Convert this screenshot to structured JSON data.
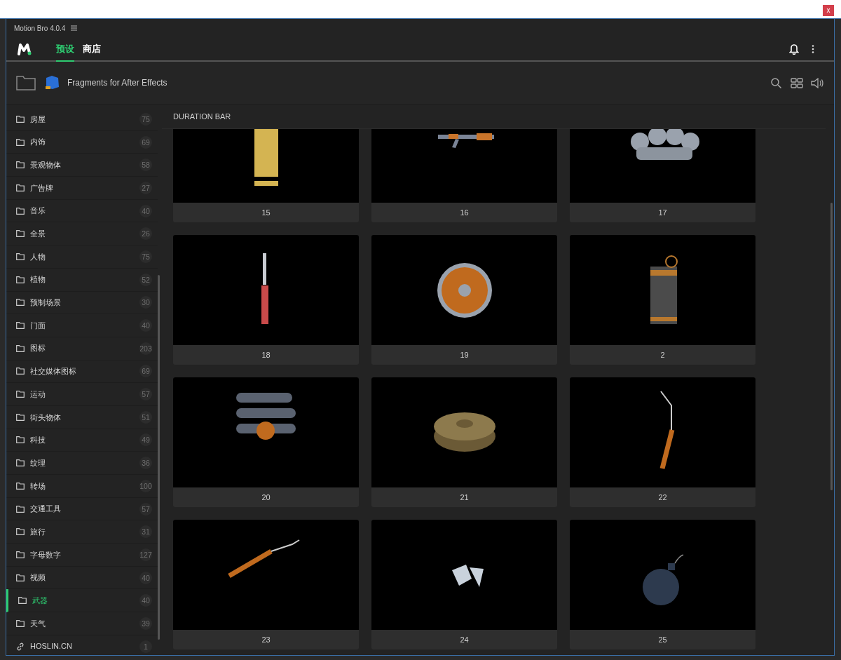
{
  "window": {
    "title": "Motion Bro 4.0.4",
    "close": "x"
  },
  "tabs": [
    {
      "label": "预设",
      "selected": true
    },
    {
      "label": "商店",
      "selected": false
    }
  ],
  "toolbar": {
    "pack": "Fragments for After Effects"
  },
  "sidebar": {
    "items": [
      {
        "kind": "folder",
        "label": "房屋",
        "count": "75",
        "selected": false
      },
      {
        "kind": "folder",
        "label": "内饰",
        "count": "69",
        "selected": false
      },
      {
        "kind": "folder",
        "label": "景观物体",
        "count": "58",
        "selected": false
      },
      {
        "kind": "folder",
        "label": "广告牌",
        "count": "27",
        "selected": false
      },
      {
        "kind": "folder",
        "label": "音乐",
        "count": "40",
        "selected": false
      },
      {
        "kind": "folder",
        "label": "全景",
        "count": "26",
        "selected": false
      },
      {
        "kind": "folder",
        "label": "人物",
        "count": "75",
        "selected": false
      },
      {
        "kind": "folder",
        "label": "植物",
        "count": "52",
        "selected": false
      },
      {
        "kind": "folder",
        "label": "预制场景",
        "count": "30",
        "selected": false
      },
      {
        "kind": "folder",
        "label": "门面",
        "count": "40",
        "selected": false
      },
      {
        "kind": "folder",
        "label": "图标",
        "count": "203",
        "selected": false
      },
      {
        "kind": "folder",
        "label": "社交媒体图标",
        "count": "69",
        "selected": false
      },
      {
        "kind": "folder",
        "label": "运动",
        "count": "57",
        "selected": false
      },
      {
        "kind": "folder",
        "label": "街头物体",
        "count": "51",
        "selected": false
      },
      {
        "kind": "folder",
        "label": "科技",
        "count": "49",
        "selected": false
      },
      {
        "kind": "folder",
        "label": "纹理",
        "count": "36",
        "selected": false
      },
      {
        "kind": "folder",
        "label": "转场",
        "count": "100",
        "selected": false
      },
      {
        "kind": "folder",
        "label": "交通工具",
        "count": "57",
        "selected": false
      },
      {
        "kind": "folder",
        "label": "旅行",
        "count": "31",
        "selected": false
      },
      {
        "kind": "folder",
        "label": "字母数字",
        "count": "127",
        "selected": false
      },
      {
        "kind": "folder",
        "label": "视频",
        "count": "40",
        "selected": false
      },
      {
        "kind": "folder",
        "label": "武器",
        "count": "40",
        "selected": true
      },
      {
        "kind": "folder",
        "label": "天气",
        "count": "39",
        "selected": false
      },
      {
        "kind": "link",
        "label": "HOSLIN.CN",
        "count": "1",
        "selected": false
      }
    ]
  },
  "content": {
    "section": "DURATION BAR",
    "cards": [
      {
        "label": "15"
      },
      {
        "label": "16"
      },
      {
        "label": "17"
      },
      {
        "label": "18"
      },
      {
        "label": "19"
      },
      {
        "label": "2"
      },
      {
        "label": "20"
      },
      {
        "label": "21"
      },
      {
        "label": "22"
      },
      {
        "label": "23"
      },
      {
        "label": "24"
      },
      {
        "label": "25"
      }
    ]
  }
}
